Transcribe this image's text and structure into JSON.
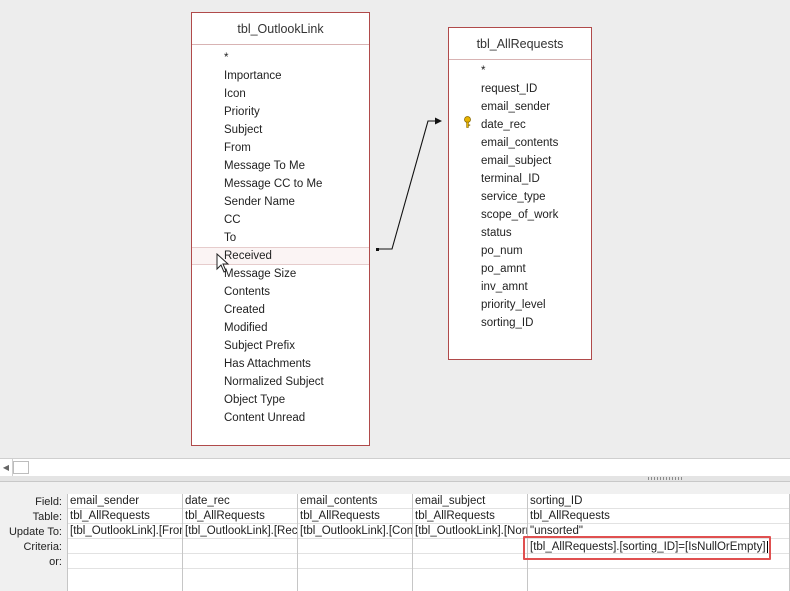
{
  "tables": [
    {
      "id": "outlook",
      "title": "tbl_OutlookLink",
      "fields": [
        "*",
        "Importance",
        "Icon",
        "Priority",
        "Subject",
        "From",
        "Message To Me",
        "Message CC to Me",
        "Sender Name",
        "CC",
        "To",
        "Received",
        "Message Size",
        "Contents",
        "Created",
        "Modified",
        "Subject Prefix",
        "Has Attachments",
        "Normalized Subject",
        "Object Type",
        "Content Unread"
      ],
      "selected_field": "Received"
    },
    {
      "id": "requests",
      "title": "tbl_AllRequests",
      "fields": [
        "*",
        "request_ID",
        "email_sender",
        "date_rec",
        "email_contents",
        "email_subject",
        "terminal_ID",
        "service_type",
        "scope_of_work",
        "status",
        "po_num",
        "po_amnt",
        "inv_amnt",
        "priority_level",
        "sorting_ID"
      ],
      "key_field": "date_rec",
      "key_icon": "primary-key-icon"
    }
  ],
  "relationship": {
    "from": "Received",
    "to": "date_rec"
  },
  "grid": {
    "row_labels": [
      "Field:",
      "Table:",
      "Update To:",
      "Criteria:",
      "or:"
    ],
    "columns": [
      {
        "field": "email_sender",
        "table": "tbl_AllRequests",
        "update_to": "[tbl_OutlookLink].[From]",
        "criteria": "",
        "or": ""
      },
      {
        "field": "date_rec",
        "table": "tbl_AllRequests",
        "update_to": "[tbl_OutlookLink].[Received]",
        "criteria": "",
        "or": ""
      },
      {
        "field": "email_contents",
        "table": "tbl_AllRequests",
        "update_to": "[tbl_OutlookLink].[Contents]",
        "criteria": "",
        "or": ""
      },
      {
        "field": "email_subject",
        "table": "tbl_AllRequests",
        "update_to": "[tbl_OutlookLink].[Normalized Subject]",
        "criteria": "",
        "or": ""
      },
      {
        "field": "sorting_ID",
        "table": "tbl_AllRequests",
        "update_to": "\"unsorted\"",
        "criteria": "[tbl_AllRequests].[sorting_ID]=[IsNullOrEmpty]",
        "or": ""
      }
    ]
  }
}
